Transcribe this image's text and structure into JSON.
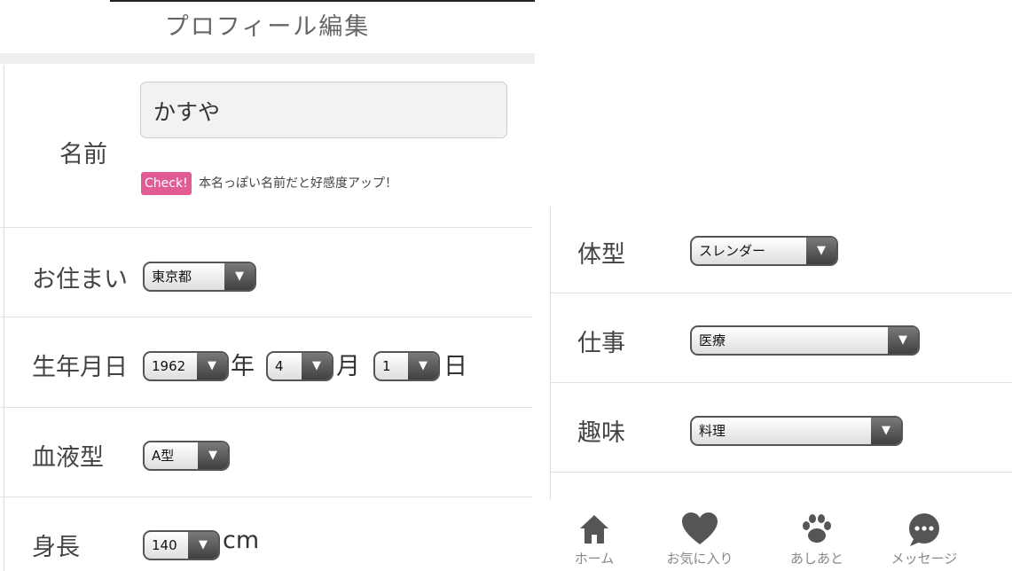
{
  "header": {
    "title": "プロフィール編集"
  },
  "profile": {
    "name": {
      "label": "名前",
      "value": "かすや",
      "badge": "Check!",
      "hint": "本名っぽい名前だと好感度アップ！"
    },
    "residence": {
      "label": "お住まい",
      "value": "東京都"
    },
    "birthday": {
      "label": "生年月日",
      "year": "1962",
      "year_unit": "年",
      "month": "4",
      "month_unit": "月",
      "day": "1",
      "day_unit": "日"
    },
    "blood_type": {
      "label": "血液型",
      "value": "A型"
    },
    "height": {
      "label": "身長",
      "value": "140",
      "unit": "cm"
    },
    "body_type": {
      "label": "体型",
      "value": "スレンダー"
    },
    "job": {
      "label": "仕事",
      "value": "医療"
    },
    "hobby": {
      "label": "趣味",
      "value": "料理"
    }
  },
  "tabbar": {
    "items": [
      {
        "label": "ホーム",
        "icon": "home-icon"
      },
      {
        "label": "お気に入り",
        "icon": "heart-icon"
      },
      {
        "label": "あしあと",
        "icon": "paw-icon"
      },
      {
        "label": "メッセージ",
        "icon": "chat-bubble-icon"
      }
    ]
  },
  "colors": {
    "accent": "#e25c94",
    "icon_gray": "#555555",
    "select_arrow": "#4a4a4a"
  }
}
